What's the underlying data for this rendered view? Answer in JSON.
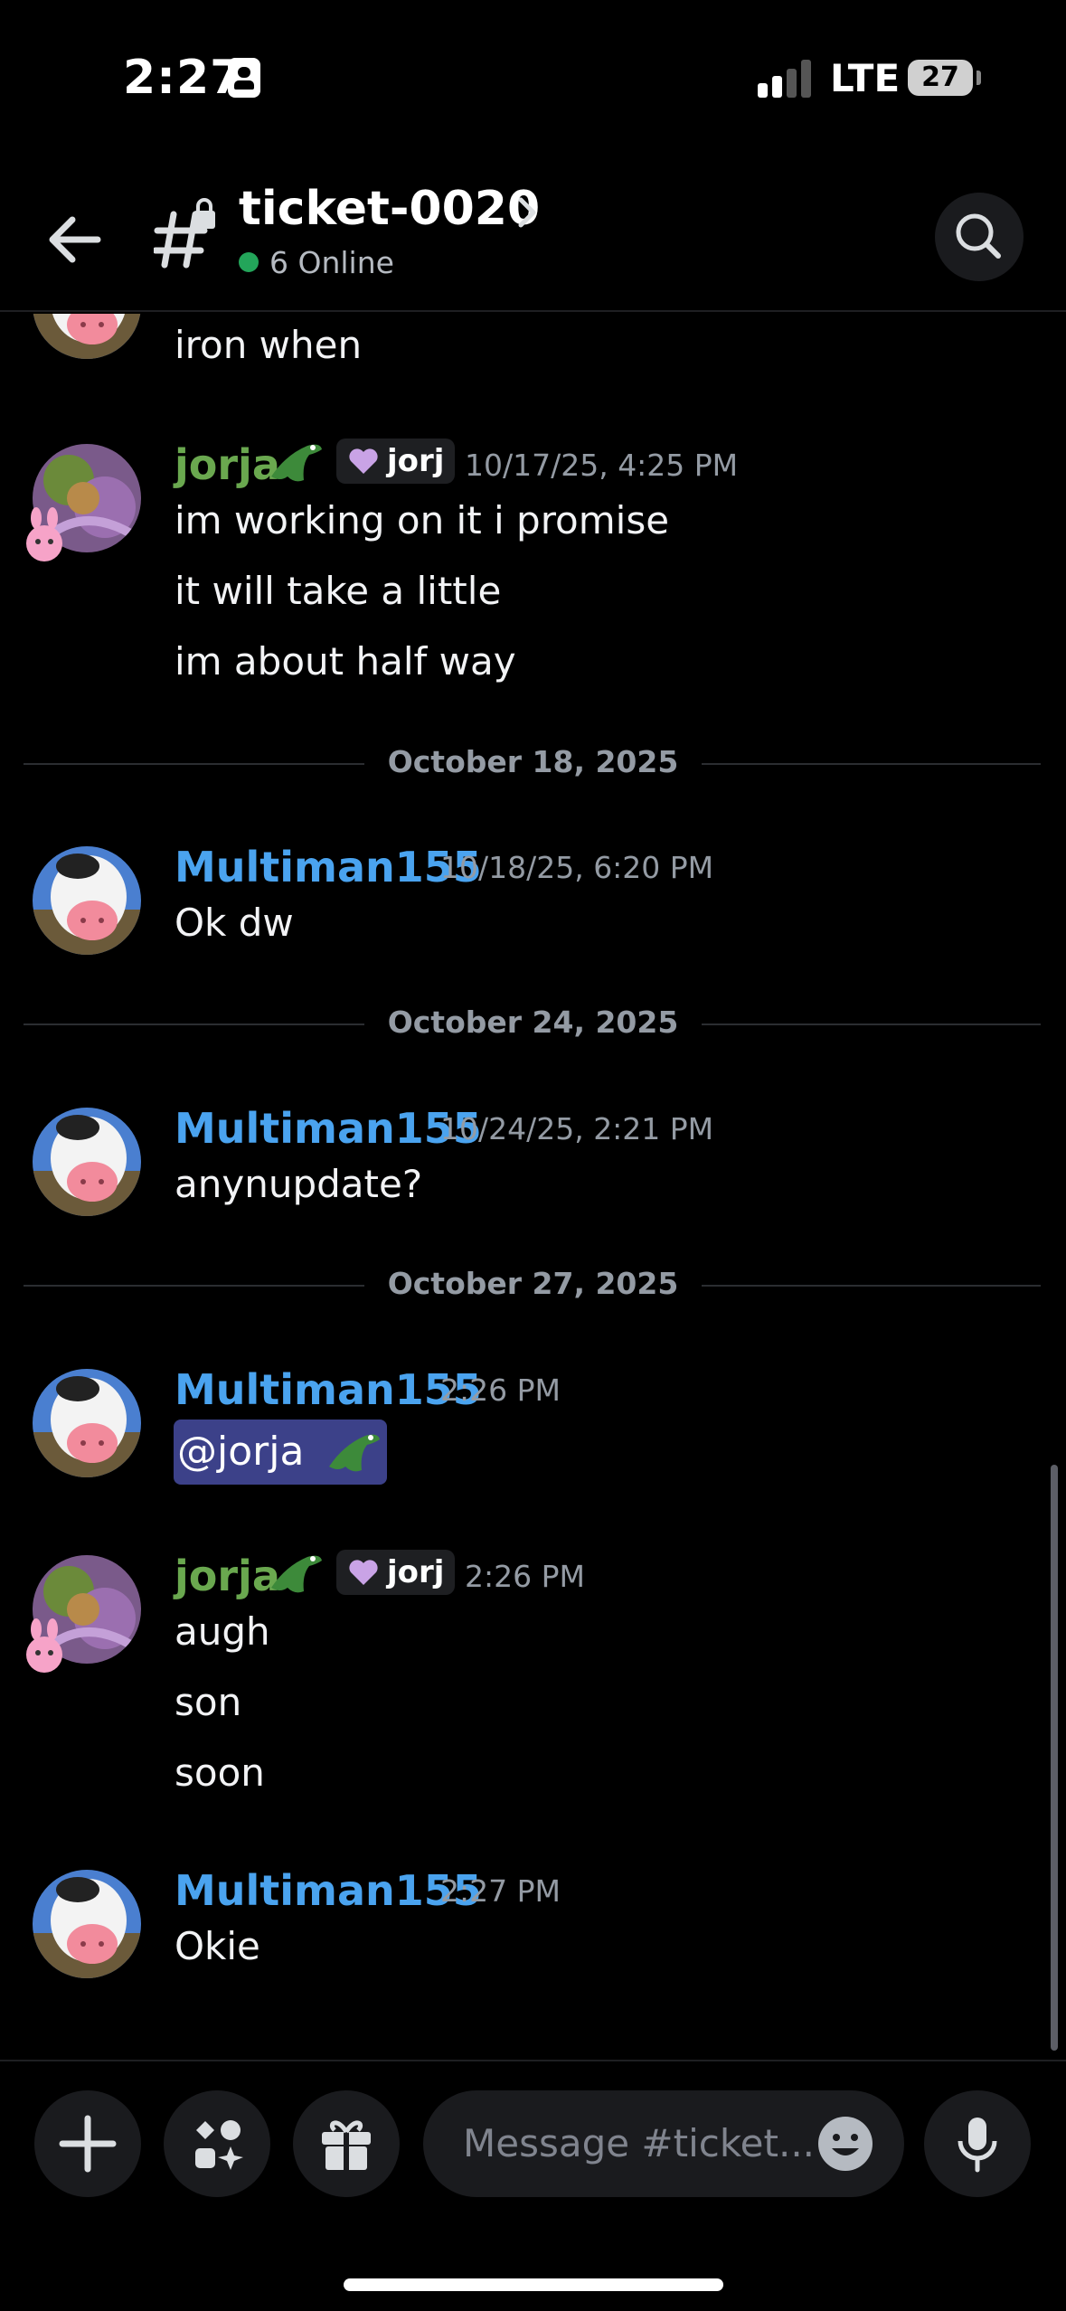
{
  "status_bar": {
    "time": "2:27",
    "network": "LTE",
    "battery": "27"
  },
  "header": {
    "channel_name": "ticket-0020",
    "online_count": "6 Online"
  },
  "messages": [
    {
      "author": "",
      "role_tag": "",
      "timestamp": "",
      "lines": [
        "iron when"
      ]
    },
    {
      "author": "jorja",
      "role_tag": "jorj",
      "timestamp": "10/17/25, 4:25 PM",
      "lines": [
        "im working on it i promise",
        "it will take a little",
        "im about half way"
      ]
    },
    {
      "author": "Multiman155",
      "role_tag": "",
      "timestamp": "10/18/25, 6:20 PM",
      "lines": [
        "Ok dw"
      ]
    },
    {
      "author": "Multiman155",
      "role_tag": "",
      "timestamp": "10/24/25, 2:21 PM",
      "lines": [
        "anynupdate?"
      ]
    },
    {
      "author": "Multiman155",
      "role_tag": "",
      "timestamp": "2:26 PM",
      "lines": [
        "@jorja"
      ]
    },
    {
      "author": "jorja",
      "role_tag": "jorj",
      "timestamp": "2:26 PM",
      "lines": [
        "augh",
        "son",
        "soon"
      ]
    },
    {
      "author": "Multiman155",
      "role_tag": "",
      "timestamp": "2:27 PM",
      "lines": [
        "Okie"
      ]
    }
  ],
  "dividers": [
    "October 18, 2025",
    "October 24, 2025",
    "October 27, 2025"
  ],
  "composer": {
    "placeholder": "Message #ticket..."
  },
  "colors": {
    "background": "#000000",
    "link_blue": "#4aa3ef",
    "role_green": "#6aa84f",
    "online_green": "#23a55a",
    "mention_bg": "#3c4189",
    "muted_text": "#949ba4"
  },
  "icons": [
    "back-arrow-icon",
    "locked-channel-icon",
    "chevron-right-icon",
    "search-icon",
    "plus-icon",
    "apps-icon",
    "gift-icon",
    "emoji-icon",
    "microphone-icon",
    "crocodile-icon",
    "heart-icon"
  ]
}
